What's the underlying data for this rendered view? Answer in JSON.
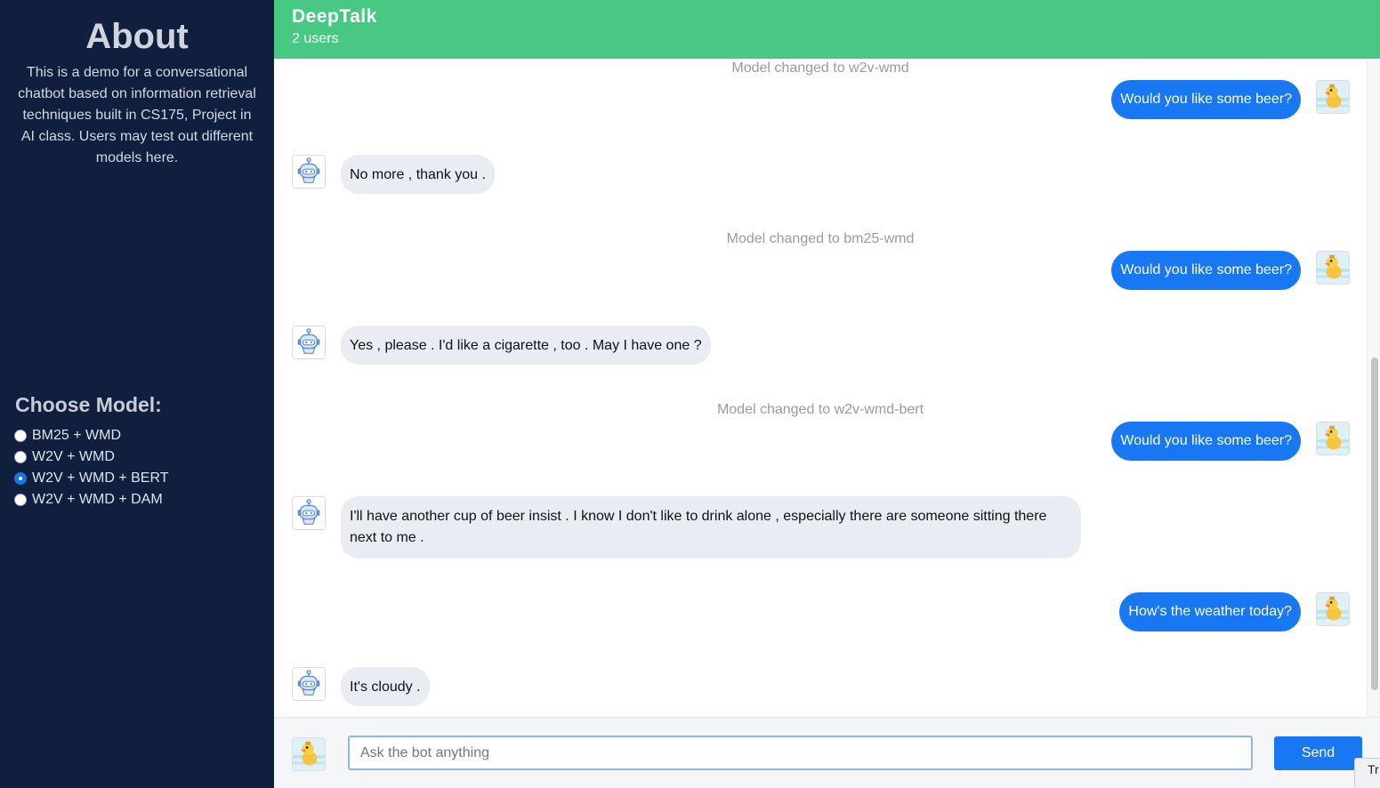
{
  "sidebar": {
    "about_title": "About",
    "about_text": "This is a demo for a conversational chatbot based on information retrieval techniques built in CS175, Project in AI class. Users may test out different models here.",
    "choose_title": "Choose Model:",
    "models": [
      {
        "label": "BM25 + WMD",
        "checked": false
      },
      {
        "label": "W2V + WMD",
        "checked": false
      },
      {
        "label": "W2V + WMD + BERT",
        "checked": true
      },
      {
        "label": "W2V + WMD + DAM",
        "checked": false
      }
    ]
  },
  "header": {
    "title": "DeepTalk",
    "users": "2 users"
  },
  "chat": {
    "messages": [
      {
        "type": "system",
        "text": "Model changed to w2v-wmd"
      },
      {
        "type": "user",
        "text": "Would you like some beer?"
      },
      {
        "type": "bot",
        "text": "No more , thank you ."
      },
      {
        "type": "system",
        "text": "Model changed to bm25-wmd"
      },
      {
        "type": "user",
        "text": "Would you like some beer?"
      },
      {
        "type": "bot",
        "text": "Yes , please . I'd like a cigarette , too . May I have one ?"
      },
      {
        "type": "system",
        "text": "Model changed to w2v-wmd-bert"
      },
      {
        "type": "user",
        "text": "Would you like some beer?"
      },
      {
        "type": "bot",
        "text": "I'll have another cup of beer insist . I know I don't like to drink alone , especially there are someone sitting there next to me ."
      },
      {
        "type": "user",
        "text": "How's the weather today?"
      },
      {
        "type": "bot",
        "text": "It's cloudy ."
      }
    ]
  },
  "composer": {
    "placeholder": "Ask the bot anything",
    "value": "",
    "send_label": "Send"
  },
  "corner_tab": {
    "label": "Tr"
  },
  "colors": {
    "sidebar_bg": "#0f1f3d",
    "header_bg": "#47c984",
    "user_bubble": "#1877f2",
    "bot_bubble": "#e9ecf2"
  }
}
